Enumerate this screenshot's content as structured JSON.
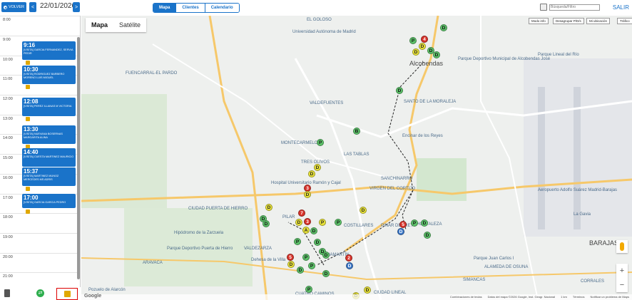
{
  "topbar": {
    "back_label": "VOLVER",
    "prev_arrow": "<",
    "date": "22/01/2026",
    "next_arrow": ">",
    "tabs": [
      {
        "label": "Mapa",
        "active": true
      },
      {
        "label": "Clientes",
        "active": false
      },
      {
        "label": "Calendario",
        "active": false
      }
    ],
    "search_placeholder": "Búsqueda/Filtro",
    "exit_label": "SALIR"
  },
  "timeline": {
    "hours": [
      "8:00",
      "9:00",
      "10:00",
      "11:00",
      "12:00",
      "13:00",
      "14:00",
      "15:00",
      "16:00",
      "17:00",
      "18:00",
      "19:00",
      "20:00",
      "21:00"
    ],
    "appointments": [
      {
        "time": "9:16",
        "desc": "[VISITA] GARCIA FERNANDEZ, SERVIA PEDIR"
      },
      {
        "time": "10:30",
        "desc": "[VISITA] RODRIGUEZ BARBERO MORENO LUIS MIGUEL"
      },
      {
        "time": "12:08",
        "desc": "[VISITA] PEREZ ILLANAS M VICTORIA"
      },
      {
        "time": "13:30",
        "desc": "[VISITA] NUEVANA BOSERNAS MARGARITA ALINA"
      },
      {
        "time": "14:40",
        "desc": "[VISITA] CUESTA MARTINEZ MAURICIO"
      },
      {
        "time": "15:37",
        "desc": "[VISITA] MARTINEZ MUNOZ MERCEDES MS ADRIS"
      },
      {
        "time": "17:00",
        "desc": "[VISITA] GARCIA GARCIA PEDRO"
      }
    ]
  },
  "map": {
    "type_options": [
      {
        "label": "Mapa",
        "active": true
      },
      {
        "label": "Satélite",
        "active": false
      }
    ],
    "controls": [
      "Modo info",
      "Desagrupar P/D/s",
      "Mi ubicación",
      "Tráfico"
    ],
    "places": [
      "FUENCARRAL-EL PARDO",
      "Alcobendas",
      "Encinar de los Reyes",
      "SANCHINARRO",
      "VIRGEN DEL CORTIJO",
      "LAS TABLAS",
      "MONTECARMELO",
      "TRES OLIVOS",
      "PILAR",
      "VALDEZARZA",
      "BARAJAS",
      "HORTALEZA",
      "Aeropuerto Adolfo Suárez Madrid-Barajas",
      "Parque Juan Carlos I",
      "COSTILLARES",
      "PINAR DEL REY",
      "CUATRO CAMINOS",
      "Pozuelo de Alarcón",
      "ARAVACA",
      "Hipódromo de la Zarzuela",
      "Parque Deportivo Puerta de Hierro",
      "Dehesa de la Villa",
      "CIUDAD LINEAL",
      "SANTO DE LA MORALEJA",
      "VALDEFUENTES",
      "CIUDAD PUERTA DE HIERRO",
      "ALAMEDA DE OSUNA",
      "SIMANCAS",
      "Hospital Universitario Ramón y Cajal",
      "Universidad Autónoma de Madrid",
      "EL GOLOSO",
      "Parque Deportivo Municipal de Alcobendas José",
      "Parque Lineal del Río",
      "La Gavia",
      "CORRALES",
      "CHAMARTÍN"
    ],
    "markers": [
      {
        "label": "D",
        "color": "y"
      },
      {
        "label": "P",
        "color": "g"
      },
      {
        "label": "B",
        "color": "g"
      },
      {
        "label": "D",
        "color": "y"
      },
      {
        "label": "A",
        "color": "y"
      },
      {
        "label": "D",
        "color": "b"
      },
      {
        "label": "4",
        "color": "r"
      },
      {
        "label": "3",
        "color": "r"
      },
      {
        "label": "7",
        "color": "r"
      },
      {
        "label": "2",
        "color": "r"
      },
      {
        "label": "6",
        "color": "r"
      },
      {
        "label": "5",
        "color": "r"
      }
    ],
    "attribution": [
      "Combinaciones de teclas",
      "Datos del mapa ©2026 Google, Inst. Geogr. Nacional",
      "1 km",
      "Términos",
      "Notificar un problema de Maps"
    ],
    "google_logo": "Google",
    "zoom_in": "+",
    "zoom_out": "−"
  }
}
